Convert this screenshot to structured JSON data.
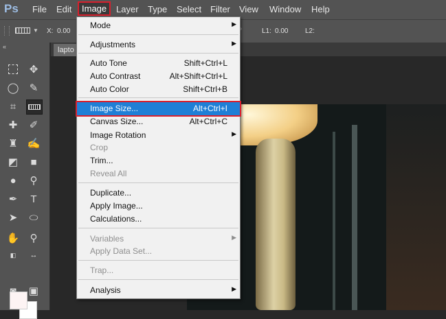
{
  "app": {
    "logo": "Ps",
    "menubar": [
      "File",
      "Edit",
      "Image",
      "Layer",
      "Type",
      "Select",
      "Filter",
      "View",
      "Window",
      "Help"
    ]
  },
  "options_bar": {
    "x_label": "X:",
    "x_value": "0.00",
    "degree": "°",
    "l1_label": "L1:",
    "l1_value": "0.00",
    "l2_label": "L2:"
  },
  "document": {
    "tab_label": "lapto"
  },
  "toolbar": {
    "collapse_glyph": "«"
  },
  "image_menu": {
    "mode": "Mode",
    "adjustments": "Adjustments",
    "auto_tone": "Auto Tone",
    "auto_tone_sc": "Shift+Ctrl+L",
    "auto_contrast": "Auto Contrast",
    "auto_contrast_sc": "Alt+Shift+Ctrl+L",
    "auto_color": "Auto Color",
    "auto_color_sc": "Shift+Ctrl+B",
    "image_size": "Image Size...",
    "image_size_sc": "Alt+Ctrl+I",
    "canvas_size": "Canvas Size...",
    "canvas_size_sc": "Alt+Ctrl+C",
    "image_rotation": "Image Rotation",
    "crop": "Crop",
    "trim": "Trim...",
    "reveal_all": "Reveal All",
    "duplicate": "Duplicate...",
    "apply_image": "Apply Image...",
    "calculations": "Calculations...",
    "variables": "Variables",
    "apply_data_set": "Apply Data Set...",
    "trap": "Trap...",
    "analysis": "Analysis"
  },
  "colors": {
    "highlight": "#1f7fd6",
    "annotation_red": "#d9202d",
    "foreground_swatch": "#fdf4f4",
    "background_swatch": "#ffffff"
  }
}
